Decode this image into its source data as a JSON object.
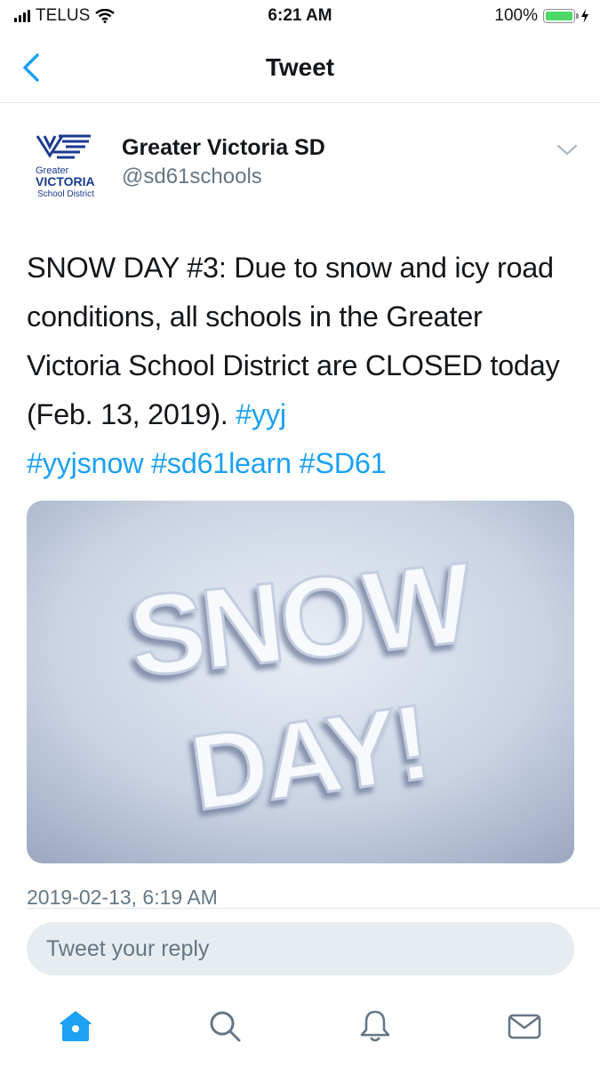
{
  "status_bar": {
    "carrier": "TELUS",
    "time": "6:21 AM",
    "battery": "100%",
    "battery_level": 1.0
  },
  "nav": {
    "title": "Tweet",
    "back_icon": "chevron-left-icon"
  },
  "tweet": {
    "author_name": "Greater Victoria SD",
    "author_handle": "@sd61schools",
    "avatar_logo": {
      "line1": "Greater",
      "line2": "VICTORIA",
      "line3": "School District"
    },
    "text": "SNOW DAY #3: Due to snow and icy road conditions, all schools in the Greater Victoria School District are CLOSED today (Feb. 13, 2019). ",
    "hashtags": [
      "#yyj",
      "#yyjsnow",
      "#sd61learn",
      "#SD61"
    ],
    "image": {
      "words": [
        "SNOW",
        "DAY!"
      ]
    },
    "timestamp": "2019-02-13, 6:19 AM"
  },
  "reply": {
    "placeholder": "Tweet your reply"
  },
  "tabbar": {
    "icons": [
      "home-icon",
      "search-icon",
      "notifications-icon",
      "messages-icon"
    ]
  },
  "colors": {
    "accent": "#1da1f2",
    "text": "#14171a",
    "secondary": "#657786",
    "battery": "#4cd964"
  }
}
